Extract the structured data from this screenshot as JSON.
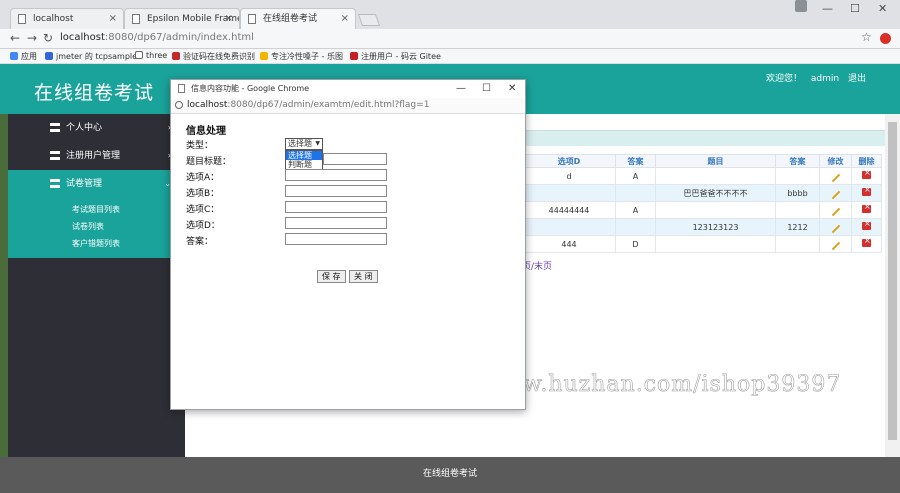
{
  "browser": {
    "tabs": [
      {
        "label": "localhost"
      },
      {
        "label": "Epsilon Mobile Framew"
      },
      {
        "label": "在线组卷考试"
      }
    ],
    "url_host": "localhost",
    "url_path": ":8080/dp67/admin/index.html",
    "bookmarks": [
      {
        "label": "应用",
        "color": "#4285f4"
      },
      {
        "label": "jmeter 的 tcpsample",
        "color": "#3367d6"
      },
      {
        "label": "three",
        "color": "#444444"
      },
      {
        "label": "验证码在线免费识别",
        "color": "#c62828"
      },
      {
        "label": "专注冷性嗓子 - 乐图",
        "color": "#f4b400"
      },
      {
        "label": "注册用户 - 码云 Gitee",
        "color": "#c71d23"
      }
    ]
  },
  "app": {
    "title": "在线组卷考试",
    "welcome": "欢迎您！",
    "username": "admin",
    "logout": "退出",
    "footer": "在线组卷考试"
  },
  "sidebar": {
    "items": [
      {
        "label": "个人中心"
      },
      {
        "label": "注册用户管理"
      },
      {
        "label": "试卷管理"
      }
    ],
    "subitems": [
      {
        "label": "考试题目列表"
      },
      {
        "label": "试卷列表"
      },
      {
        "label": "客户错题列表"
      }
    ]
  },
  "table": {
    "headers": [
      "选项D",
      "答案",
      "题目",
      "答案",
      "修改",
      "删除"
    ],
    "rows": [
      {
        "optd": "d",
        "ans": "A",
        "title": "",
        "ans2": ""
      },
      {
        "optd": "",
        "ans": "",
        "title": "巴巴爸爸不不不不",
        "ans2": "bbbb"
      },
      {
        "optd": "44444444",
        "ans": "A",
        "title": "",
        "ans2": ""
      },
      {
        "optd": "",
        "ans": "",
        "title": "123123123",
        "ans2": "1212"
      },
      {
        "optd": "444",
        "ans": "D",
        "title": "",
        "ans2": ""
      }
    ],
    "stray_digit": "8",
    "pager": "页/末页"
  },
  "popup": {
    "window_title": "信息内容功能 - Google Chrome",
    "url_host": "localhost",
    "url_path": ":8080/dp67/admin/examtm/edit.html?flag=1",
    "form_title": "信息处理",
    "labels": {
      "type": "类型：",
      "question": "题目标题：",
      "opta": "选项A：",
      "optb": "选项B：",
      "optc": "选项C：",
      "optd": "选项D：",
      "answer": "答案："
    },
    "type_selected": "选择题",
    "type_options": [
      "选择题",
      "判断题"
    ],
    "save": "保 存",
    "close": "关 闭"
  },
  "watermark": "https://www.huzhan.com/ishop39397",
  "colors": {
    "accent": "#1aa39b",
    "sidebar": "#2e2f36",
    "footer": "#5a5a5a"
  }
}
